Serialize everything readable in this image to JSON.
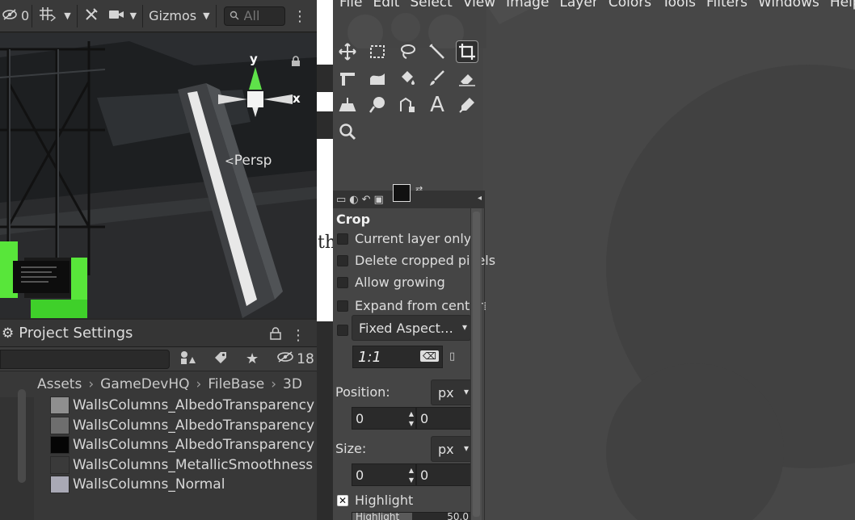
{
  "unity": {
    "toolbar": {
      "visibility_count": "0",
      "gizmos_label": "Gizmos",
      "search_placeholder": "All"
    },
    "scene": {
      "axis_y": "y",
      "axis_x": "x",
      "projection_label": "Persp"
    },
    "project_settings": {
      "title": "Project Settings",
      "hidden_count": "18",
      "breadcrumb": [
        "Assets",
        "GameDevHQ",
        "FileBase",
        "3D"
      ],
      "files": [
        {
          "name": "WallsColumns_AlbedoTransparency",
          "thumb": "#8f8f8f"
        },
        {
          "name": "WallsColumns_AlbedoTransparency",
          "thumb": "#6e6e6e"
        },
        {
          "name": "WallsColumns_AlbedoTransparency",
          "thumb": "#050505"
        },
        {
          "name": "WallsColumns_MetallicSmoothness",
          "thumb": "#3a3a3a"
        },
        {
          "name": "WallsColumns_Normal",
          "thumb": "#a9a9b5"
        }
      ]
    }
  },
  "strip": {
    "fragment_text": "th"
  },
  "gimp": {
    "menu": [
      "File",
      "Edit",
      "Select",
      "View",
      "Image",
      "Layer",
      "Colors",
      "Tools",
      "Filters",
      "Windows",
      "Help"
    ],
    "tool_options": {
      "title": "Crop",
      "checkboxes": [
        {
          "label": "Current layer only",
          "checked": false
        },
        {
          "label": "Delete cropped pixels",
          "checked": false
        },
        {
          "label": "Allow growing",
          "checked": false
        },
        {
          "label": "Expand from center",
          "checked": false
        }
      ],
      "fixed_aspect_label": "Fixed Aspect ratio",
      "ratio_value": "1:1",
      "position_label": "Position:",
      "position_unit": "px",
      "position_x": "0",
      "position_y": "0",
      "size_label": "Size:",
      "size_unit": "px",
      "size_w": "0",
      "size_h": "0",
      "highlight_label": "Highlight",
      "highlight_checked": true,
      "highlight_opacity_label": "Highlight",
      "highlight_opacity_value": "50.0"
    },
    "colors": {
      "foreground": "#111111",
      "background": "#eeeeee"
    }
  }
}
